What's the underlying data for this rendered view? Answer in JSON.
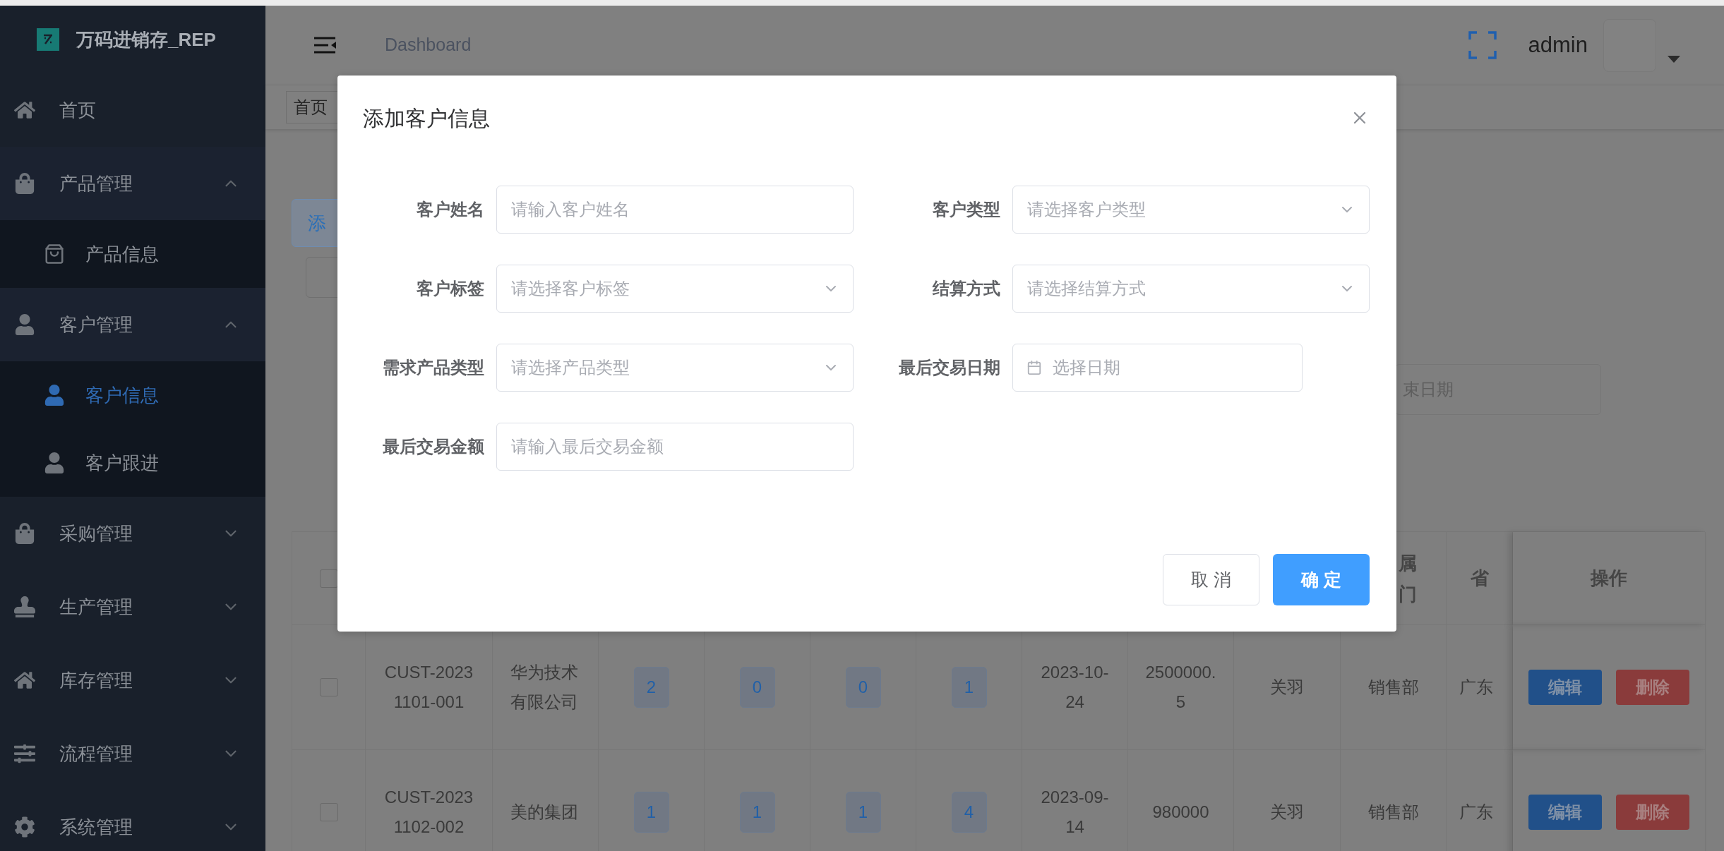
{
  "sidebar": {
    "logo_text": "万码进销存_REP",
    "items": [
      {
        "label": "首页",
        "selected": false
      },
      {
        "label": "产品管理",
        "selected": false,
        "expanded": true,
        "children": [
          {
            "label": "产品信息",
            "selected": false
          }
        ]
      },
      {
        "label": "客户管理",
        "selected": false,
        "expanded": true,
        "children": [
          {
            "label": "客户信息",
            "selected": true
          },
          {
            "label": "客户跟进",
            "selected": false
          }
        ]
      },
      {
        "label": "采购管理",
        "selected": false,
        "expanded": false
      },
      {
        "label": "生产管理",
        "selected": false,
        "expanded": false
      },
      {
        "label": "库存管理",
        "selected": false,
        "expanded": false
      },
      {
        "label": "流程管理",
        "selected": false,
        "expanded": false
      },
      {
        "label": "系统管理",
        "selected": false,
        "expanded": false
      }
    ]
  },
  "topbar": {
    "breadcrumb": "Dashboard",
    "username": "admin"
  },
  "tags_bar": {
    "tag": "首页"
  },
  "toolbar": {
    "primary_button": "添"
  },
  "filter": {
    "end_date_placeholder": "束日期"
  },
  "table": {
    "header_checked": false,
    "header": {
      "column_11": [
        "属",
        "门"
      ],
      "column_12": "省",
      "column_13": "操作"
    },
    "rows": [
      {
        "checked": false,
        "id": "CUST-20231101-001",
        "name": "华为技术有限公司",
        "counts": [
          "2",
          "0",
          "0",
          "1"
        ],
        "date": "2023-10-24",
        "amount": "2500000.5",
        "owner": "关羽",
        "department": "销售部",
        "province": "广东",
        "actions": [
          "编辑",
          "删除"
        ]
      },
      {
        "checked": false,
        "id": "CUST-20231102-002",
        "name": "美的集团",
        "counts": [
          "1",
          "1",
          "1",
          "4"
        ],
        "date": "2023-09-14",
        "amount": "980000",
        "owner": "关羽",
        "department": "销售部",
        "province": "广东",
        "actions": [
          "编辑",
          "删除"
        ]
      }
    ]
  },
  "dialog": {
    "title": "添加客户信息",
    "fields": [
      {
        "label": "客户姓名",
        "kind": "text",
        "placeholder": "请输入客户姓名"
      },
      {
        "label": "客户类型",
        "kind": "select",
        "placeholder": "请选择客户类型"
      },
      {
        "label": "客户标签",
        "kind": "select",
        "placeholder": "请选择客户标签"
      },
      {
        "label": "结算方式",
        "kind": "select",
        "placeholder": "请选择结算方式"
      },
      {
        "label": "需求产品类型",
        "kind": "select",
        "placeholder": "请选择产品类型"
      },
      {
        "label": "最后交易日期",
        "kind": "date",
        "placeholder": "选择日期"
      },
      {
        "label": "最后交易金额",
        "kind": "text",
        "placeholder": "请输入最后交易金额"
      }
    ],
    "buttons": [
      {
        "label": "取消",
        "kind": "default"
      },
      {
        "label": "确定",
        "kind": "primary"
      }
    ]
  }
}
